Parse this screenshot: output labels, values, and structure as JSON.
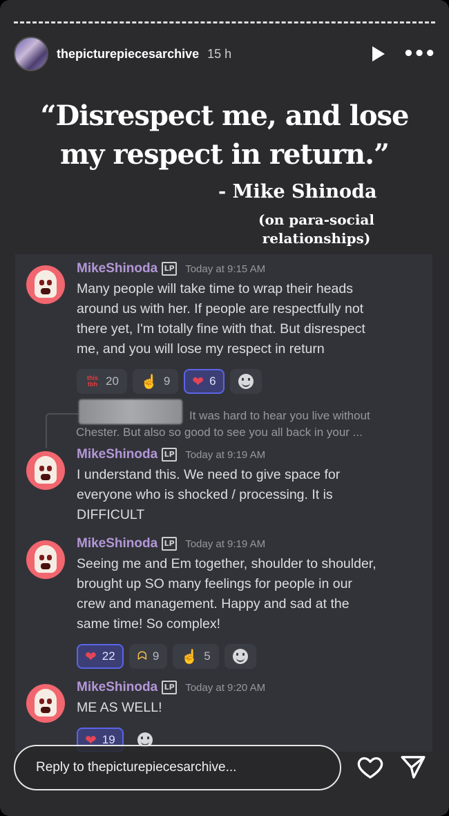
{
  "header": {
    "username": "thepicturepiecesarchive",
    "time": "15 h"
  },
  "quote": {
    "line1": "“Disrespect me, and lose",
    "line2": "my respect in return.”",
    "attribution": "- Mike Shinoda",
    "context_line1": "(on para-social",
    "context_line2": "relationships)"
  },
  "messages": [
    {
      "name": "MikeShinoda",
      "badge": "LP",
      "time": "Today at 9:15 AM",
      "lines": [
        "Many people will take time to wrap their heads",
        "around us with her. If people are respectfully not",
        "there yet, I'm totally fine with that. But disrespect",
        "me, and you will lose my respect in return"
      ],
      "reactions": [
        {
          "emoji": "this tbh",
          "count": "20",
          "active": false
        },
        {
          "emoji": "point-up",
          "count": "9",
          "active": false
        },
        {
          "emoji": "heart",
          "count": "6",
          "active": true
        }
      ]
    },
    {
      "name": "MikeShinoda",
      "badge": "LP",
      "time": "Today at 9:19 AM",
      "lines": [
        "I understand this. We need to give space for",
        "everyone who is shocked / processing. It is",
        "DIFFICULT"
      ]
    },
    {
      "name": "MikeShinoda",
      "badge": "LP",
      "time": "Today at 9:19 AM",
      "lines": [
        "Seeing me and Em together, shoulder to shoulder,",
        "brought up SO many feelings for people in our",
        "crew and management. Happy and sad at the",
        "same time! So complex!"
      ],
      "reactions": [
        {
          "emoji": "heart",
          "count": "22",
          "active": true
        },
        {
          "emoji": "heart-hands",
          "count": "9",
          "active": false
        },
        {
          "emoji": "point-up",
          "count": "5",
          "active": false
        }
      ]
    },
    {
      "name": "MikeShinoda",
      "badge": "LP",
      "time": "Today at 9:20 AM",
      "lines": [
        "ME AS WELL!"
      ],
      "reactions": [
        {
          "emoji": "heart",
          "count": "19",
          "active": true
        }
      ]
    }
  ],
  "reply_ref": {
    "line1": "It was hard to hear you live without",
    "line2": "Chester. But also so good to see you all back in your ..."
  },
  "footer": {
    "reply_placeholder": "Reply to thepicturepiecesarchive..."
  }
}
